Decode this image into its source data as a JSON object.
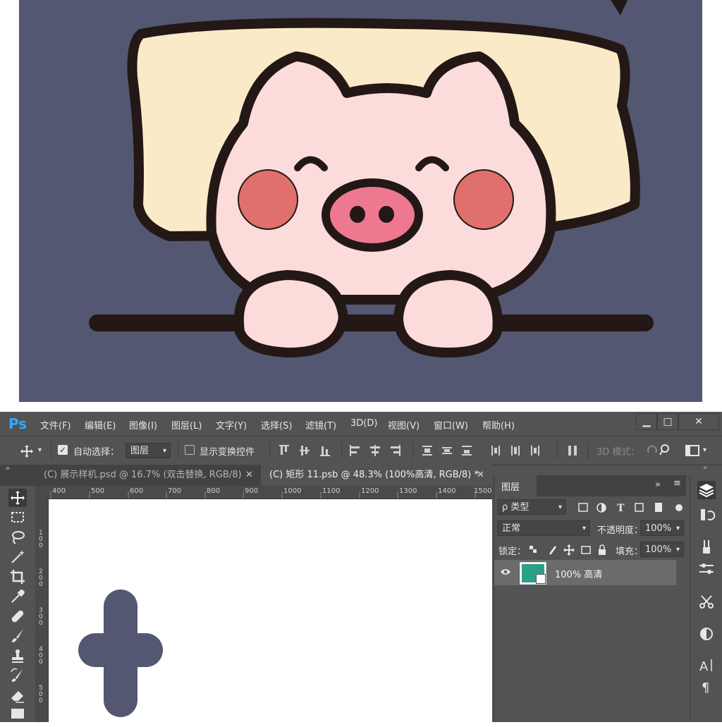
{
  "colors": {
    "art_background": "#535771",
    "pillow": "#faeac8",
    "pig_skin": "#fbdcdb",
    "cheeks": "#e0706c",
    "snout": "#ee7890",
    "outline": "#231815",
    "ps_panel": "#535353",
    "ps_blue": "#31a8ff",
    "layer_thumb": "#2aa186",
    "plus_shape": "#535771"
  },
  "app": {
    "logo": "Ps",
    "menu": [
      "文件(F)",
      "编辑(E)",
      "图像(I)",
      "图层(L)",
      "文字(Y)",
      "选择(S)",
      "滤镜(T)",
      "3D(D)",
      "视图(V)",
      "窗口(W)",
      "帮助(H)"
    ],
    "window_buttons": [
      "▁",
      "□",
      "✕"
    ]
  },
  "options": {
    "auto_select_label": "自动选择：",
    "auto_select_value": "图层",
    "show_transform_label": "显示变换控件",
    "mode_3d_label": "3D 模式："
  },
  "tabs": [
    {
      "label": "(C) 展示样机.psd @ 16.7% (双击替换, RGB/8)",
      "close": "✕"
    },
    {
      "label": "(C) 矩形 11.psb @ 48.3% (100%高清, RGB/8) *",
      "close": "✕"
    }
  ],
  "ruler": {
    "top": [
      "400",
      "500",
      "600",
      "700",
      "800",
      "900",
      "1000",
      "1100",
      "1200",
      "1300",
      "1400",
      "1500"
    ],
    "left": [
      "1\n0\n0",
      "2\n0\n0",
      "3\n0\n0",
      "4\n0\n0",
      "5\n0\n0"
    ]
  },
  "layers_panel": {
    "title": "图层",
    "filter_label": "ρ 类型",
    "blend_mode": "正常",
    "opacity_label": "不透明度：",
    "opacity_value": "100%",
    "lock_label": "锁定：",
    "fill_label": "填充：",
    "fill_value": "100%",
    "layers": [
      {
        "name": "100% 高清",
        "visible": true
      }
    ]
  }
}
